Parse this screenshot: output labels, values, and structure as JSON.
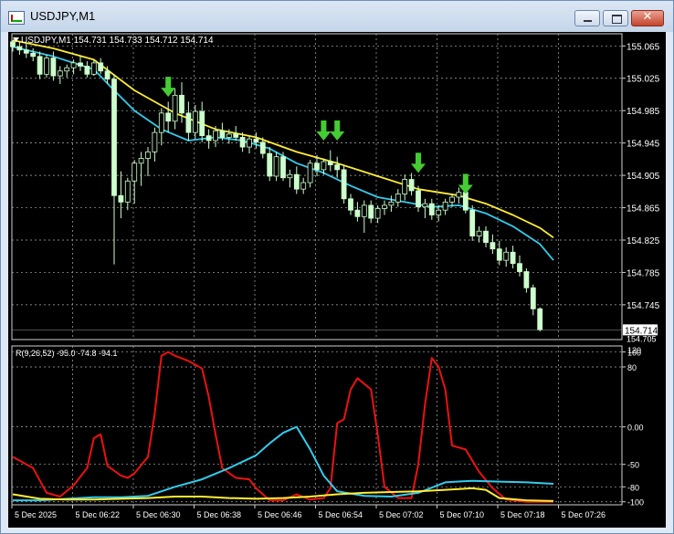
{
  "window": {
    "title": "USDJPY,M1",
    "minimize_icon": "minimize-icon",
    "maximize_icon": "maximize-icon",
    "close_icon": "close-icon",
    "close_glyph": "✕"
  },
  "colors": {
    "background": "#000000",
    "grid": "#b0b0b0",
    "text": "#ffffff",
    "candle": "#ccffcc",
    "ma_fast": "#33ccee",
    "ma_slow": "#ffee33",
    "arrow": "#44cc33",
    "osc_main": "#ee1111",
    "osc_signal1": "#33ccee",
    "osc_signal2": "#ffee33"
  },
  "chart_data": [
    {
      "type": "candlestick",
      "symbol_header": "USDJPY,M1  154.731 154.733 154.712 154.714",
      "current_price_label": "154.714",
      "partial_bottom_label": "154.705",
      "ylim": [
        154.702,
        155.08
      ],
      "yticks": [
        "155.065",
        "155.025",
        "154.985",
        "154.945",
        "154.905",
        "154.865",
        "154.825",
        "154.785",
        "154.745"
      ],
      "candles": [
        [
          155.07,
          155.072,
          155.058,
          155.064
        ],
        [
          155.064,
          155.07,
          155.054,
          155.06
        ],
        [
          155.06,
          155.068,
          155.05,
          155.056
        ],
        [
          155.056,
          155.062,
          155.046,
          155.052
        ],
        [
          155.052,
          155.058,
          155.024,
          155.03
        ],
        [
          155.03,
          155.054,
          155.026,
          155.05
        ],
        [
          155.05,
          155.058,
          155.022,
          155.028
        ],
        [
          155.028,
          155.04,
          155.018,
          155.034
        ],
        [
          155.034,
          155.042,
          155.026,
          155.038
        ],
        [
          155.038,
          155.048,
          155.03,
          155.044
        ],
        [
          155.044,
          155.052,
          155.034,
          155.04
        ],
        [
          155.04,
          155.046,
          155.026,
          155.03
        ],
        [
          155.03,
          155.048,
          155.028,
          155.044
        ],
        [
          155.044,
          155.05,
          155.03,
          155.034
        ],
        [
          155.034,
          155.04,
          155.018,
          155.024
        ],
        [
          155.024,
          155.03,
          154.795,
          154.88
        ],
        [
          154.88,
          154.91,
          154.852,
          154.872
        ],
        [
          154.872,
          154.902,
          154.862,
          154.898
        ],
        [
          154.898,
          154.924,
          154.87,
          154.92
        ],
        [
          154.92,
          154.934,
          154.892,
          154.926
        ],
        [
          154.926,
          154.94,
          154.904,
          154.934
        ],
        [
          154.934,
          154.964,
          154.922,
          154.958
        ],
        [
          154.958,
          154.988,
          154.942,
          154.982
        ],
        [
          154.982,
          154.996,
          154.958,
          154.972
        ],
        [
          154.972,
          155.012,
          154.962,
          155.004
        ],
        [
          155.004,
          155.02,
          154.97,
          154.982
        ],
        [
          154.982,
          154.996,
          154.948,
          154.958
        ],
        [
          154.958,
          154.992,
          154.95,
          154.984
        ],
        [
          154.984,
          154.996,
          154.946,
          154.954
        ],
        [
          154.954,
          154.962,
          154.938,
          154.948
        ],
        [
          154.948,
          154.966,
          154.94,
          154.96
        ],
        [
          154.96,
          154.97,
          154.948,
          154.952
        ],
        [
          154.952,
          154.962,
          154.944,
          154.956
        ],
        [
          154.956,
          154.966,
          154.948,
          154.952
        ],
        [
          154.952,
          154.958,
          154.934,
          154.94
        ],
        [
          154.94,
          154.954,
          154.932,
          154.95
        ],
        [
          154.95,
          154.958,
          154.938,
          154.946
        ],
        [
          154.946,
          154.952,
          154.926,
          154.932
        ],
        [
          154.932,
          154.94,
          154.898,
          154.904
        ],
        [
          154.904,
          154.934,
          154.898,
          154.928
        ],
        [
          154.928,
          154.934,
          154.898,
          154.902
        ],
        [
          154.902,
          154.912,
          154.89,
          154.906
        ],
        [
          154.906,
          154.916,
          154.882,
          154.888
        ],
        [
          154.888,
          154.902,
          154.882,
          154.896
        ],
        [
          154.896,
          154.924,
          154.89,
          154.92
        ],
        [
          154.92,
          154.93,
          154.904,
          154.912
        ],
        [
          154.912,
          154.926,
          154.906,
          154.922
        ],
        [
          154.922,
          154.936,
          154.91,
          154.918
        ],
        [
          154.918,
          154.928,
          154.902,
          154.912
        ],
        [
          154.912,
          154.918,
          154.87,
          154.876
        ],
        [
          154.876,
          154.882,
          154.856,
          154.862
        ],
        [
          154.862,
          154.872,
          154.848,
          154.854
        ],
        [
          154.854,
          154.874,
          154.834,
          154.868
        ],
        [
          154.868,
          154.874,
          154.846,
          154.852
        ],
        [
          154.852,
          154.868,
          154.846,
          154.864
        ],
        [
          154.864,
          154.874,
          154.856,
          154.868
        ],
        [
          154.868,
          154.88,
          154.86,
          154.872
        ],
        [
          154.872,
          154.888,
          154.866,
          154.882
        ],
        [
          154.882,
          154.906,
          154.874,
          154.9
        ],
        [
          154.9,
          154.908,
          154.88,
          154.886
        ],
        [
          154.886,
          154.892,
          154.86,
          154.866
        ],
        [
          154.866,
          154.876,
          154.852,
          154.87
        ],
        [
          154.87,
          154.876,
          154.85,
          154.856
        ],
        [
          154.856,
          154.868,
          154.848,
          154.862
        ],
        [
          154.862,
          154.876,
          154.856,
          154.872
        ],
        [
          154.872,
          154.882,
          154.866,
          154.878
        ],
        [
          154.878,
          154.89,
          154.87,
          154.884
        ],
        [
          154.884,
          154.888,
          154.858,
          154.862
        ],
        [
          154.862,
          154.868,
          154.824,
          154.83
        ],
        [
          154.83,
          154.842,
          154.822,
          154.836
        ],
        [
          154.836,
          154.842,
          154.816,
          154.822
        ],
        [
          154.822,
          154.832,
          154.808,
          154.814
        ],
        [
          154.814,
          154.824,
          154.794,
          154.8
        ],
        [
          154.8,
          154.816,
          154.792,
          154.81
        ],
        [
          154.81,
          154.818,
          154.79,
          154.796
        ],
        [
          154.796,
          154.806,
          154.78,
          154.786
        ],
        [
          154.786,
          154.79,
          154.76,
          154.766
        ],
        [
          154.766,
          154.77,
          154.732,
          154.74
        ],
        [
          154.74,
          154.742,
          154.712,
          154.714
        ]
      ],
      "ma_fast": [
        [
          0,
          155.064
        ],
        [
          6,
          155.052
        ],
        [
          12,
          155.036
        ],
        [
          15,
          155.01
        ],
        [
          18,
          154.985
        ],
        [
          22,
          154.962
        ],
        [
          26,
          154.948
        ],
        [
          30,
          154.952
        ],
        [
          34,
          154.948
        ],
        [
          38,
          154.938
        ],
        [
          42,
          154.92
        ],
        [
          46,
          154.908
        ],
        [
          50,
          154.892
        ],
        [
          54,
          154.878
        ],
        [
          58,
          154.872
        ],
        [
          62,
          154.866
        ],
        [
          66,
          154.868
        ],
        [
          70,
          154.858
        ],
        [
          74,
          154.842
        ],
        [
          78,
          154.82
        ],
        [
          80,
          154.8
        ]
      ],
      "ma_slow": [
        [
          0,
          155.072
        ],
        [
          6,
          155.062
        ],
        [
          12,
          155.048
        ],
        [
          18,
          155.01
        ],
        [
          24,
          154.982
        ],
        [
          30,
          154.962
        ],
        [
          36,
          154.952
        ],
        [
          42,
          154.934
        ],
        [
          48,
          154.92
        ],
        [
          54,
          154.904
        ],
        [
          60,
          154.888
        ],
        [
          66,
          154.88
        ],
        [
          70,
          154.87
        ],
        [
          74,
          154.856
        ],
        [
          78,
          154.84
        ],
        [
          80,
          154.828
        ]
      ],
      "arrows": [
        [
          23,
          155.002
        ],
        [
          46,
          154.948
        ],
        [
          48,
          154.948
        ],
        [
          60,
          154.908
        ],
        [
          67,
          154.882
        ]
      ]
    },
    {
      "type": "line",
      "header": "R(9,26,52) -95.0 -74.8 -94.1",
      "ylim": [
        -104,
        108
      ],
      "yticks": [
        "120",
        "100",
        "80",
        "0.00",
        "-50",
        "-80",
        "-100"
      ],
      "xticks": [
        "5 Dec 2025",
        "5 Dec 06:22",
        "5 Dec 06:30",
        "5 Dec 06:38",
        "5 Dec 06:46",
        "5 Dec 06:54",
        "5 Dec 07:02",
        "5 Dec 07:10",
        "5 Dec 07:18",
        "5 Dec 07:26"
      ],
      "series": [
        {
          "color": "osc_main",
          "points": [
            [
              0,
              -40
            ],
            [
              3,
              -55
            ],
            [
              5,
              -88
            ],
            [
              7,
              -93
            ],
            [
              9,
              -78
            ],
            [
              11,
              -55
            ],
            [
              12,
              -15
            ],
            [
              13,
              -10
            ],
            [
              14,
              -52
            ],
            [
              16,
              -65
            ],
            [
              17,
              -68
            ],
            [
              18,
              -62
            ],
            [
              20,
              -40
            ],
            [
              21,
              18
            ],
            [
              22,
              95
            ],
            [
              23,
              100
            ],
            [
              24,
              95
            ],
            [
              26,
              88
            ],
            [
              28,
              78
            ],
            [
              29,
              40
            ],
            [
              30,
              -10
            ],
            [
              31,
              -55
            ],
            [
              33,
              -68
            ],
            [
              35,
              -70
            ],
            [
              36,
              -82
            ],
            [
              38,
              -98
            ],
            [
              40,
              -98
            ],
            [
              42,
              -90
            ],
            [
              44,
              -97
            ],
            [
              46,
              -95
            ],
            [
              47,
              -82
            ],
            [
              48,
              5
            ],
            [
              49,
              10
            ],
            [
              50,
              50
            ],
            [
              51,
              65
            ],
            [
              53,
              50
            ],
            [
              54,
              -10
            ],
            [
              55,
              -80
            ],
            [
              57,
              -95
            ],
            [
              59,
              -95
            ],
            [
              60,
              -50
            ],
            [
              61,
              30
            ],
            [
              62,
              92
            ],
            [
              63,
              80
            ],
            [
              64,
              50
            ],
            [
              65,
              -25
            ],
            [
              67,
              -30
            ],
            [
              69,
              -60
            ],
            [
              71,
              -82
            ],
            [
              73,
              -97
            ],
            [
              76,
              -100
            ],
            [
              80,
              -100
            ]
          ]
        },
        {
          "color": "osc_signal1",
          "points": [
            [
              0,
              -98
            ],
            [
              4,
              -98
            ],
            [
              8,
              -96
            ],
            [
              12,
              -94
            ],
            [
              16,
              -94
            ],
            [
              20,
              -92
            ],
            [
              24,
              -80
            ],
            [
              28,
              -70
            ],
            [
              32,
              -55
            ],
            [
              36,
              -38
            ],
            [
              38,
              -22
            ],
            [
              40,
              -8
            ],
            [
              42,
              0
            ],
            [
              44,
              -30
            ],
            [
              46,
              -65
            ],
            [
              48,
              -86
            ],
            [
              52,
              -92
            ],
            [
              56,
              -93
            ],
            [
              60,
              -88
            ],
            [
              64,
              -74
            ],
            [
              68,
              -72
            ],
            [
              72,
              -73
            ],
            [
              76,
              -74
            ],
            [
              80,
              -76
            ]
          ]
        },
        {
          "color": "osc_signal2",
          "points": [
            [
              0,
              -90
            ],
            [
              4,
              -96
            ],
            [
              8,
              -97
            ],
            [
              12,
              -97
            ],
            [
              16,
              -96
            ],
            [
              20,
              -95
            ],
            [
              24,
              -93
            ],
            [
              28,
              -93
            ],
            [
              32,
              -95
            ],
            [
              36,
              -96
            ],
            [
              40,
              -95
            ],
            [
              44,
              -93
            ],
            [
              48,
              -90
            ],
            [
              52,
              -88
            ],
            [
              56,
              -87
            ],
            [
              60,
              -86
            ],
            [
              64,
              -84
            ],
            [
              68,
              -82
            ],
            [
              70,
              -84
            ],
            [
              72,
              -95
            ],
            [
              76,
              -98
            ],
            [
              80,
              -99
            ]
          ]
        }
      ]
    }
  ]
}
